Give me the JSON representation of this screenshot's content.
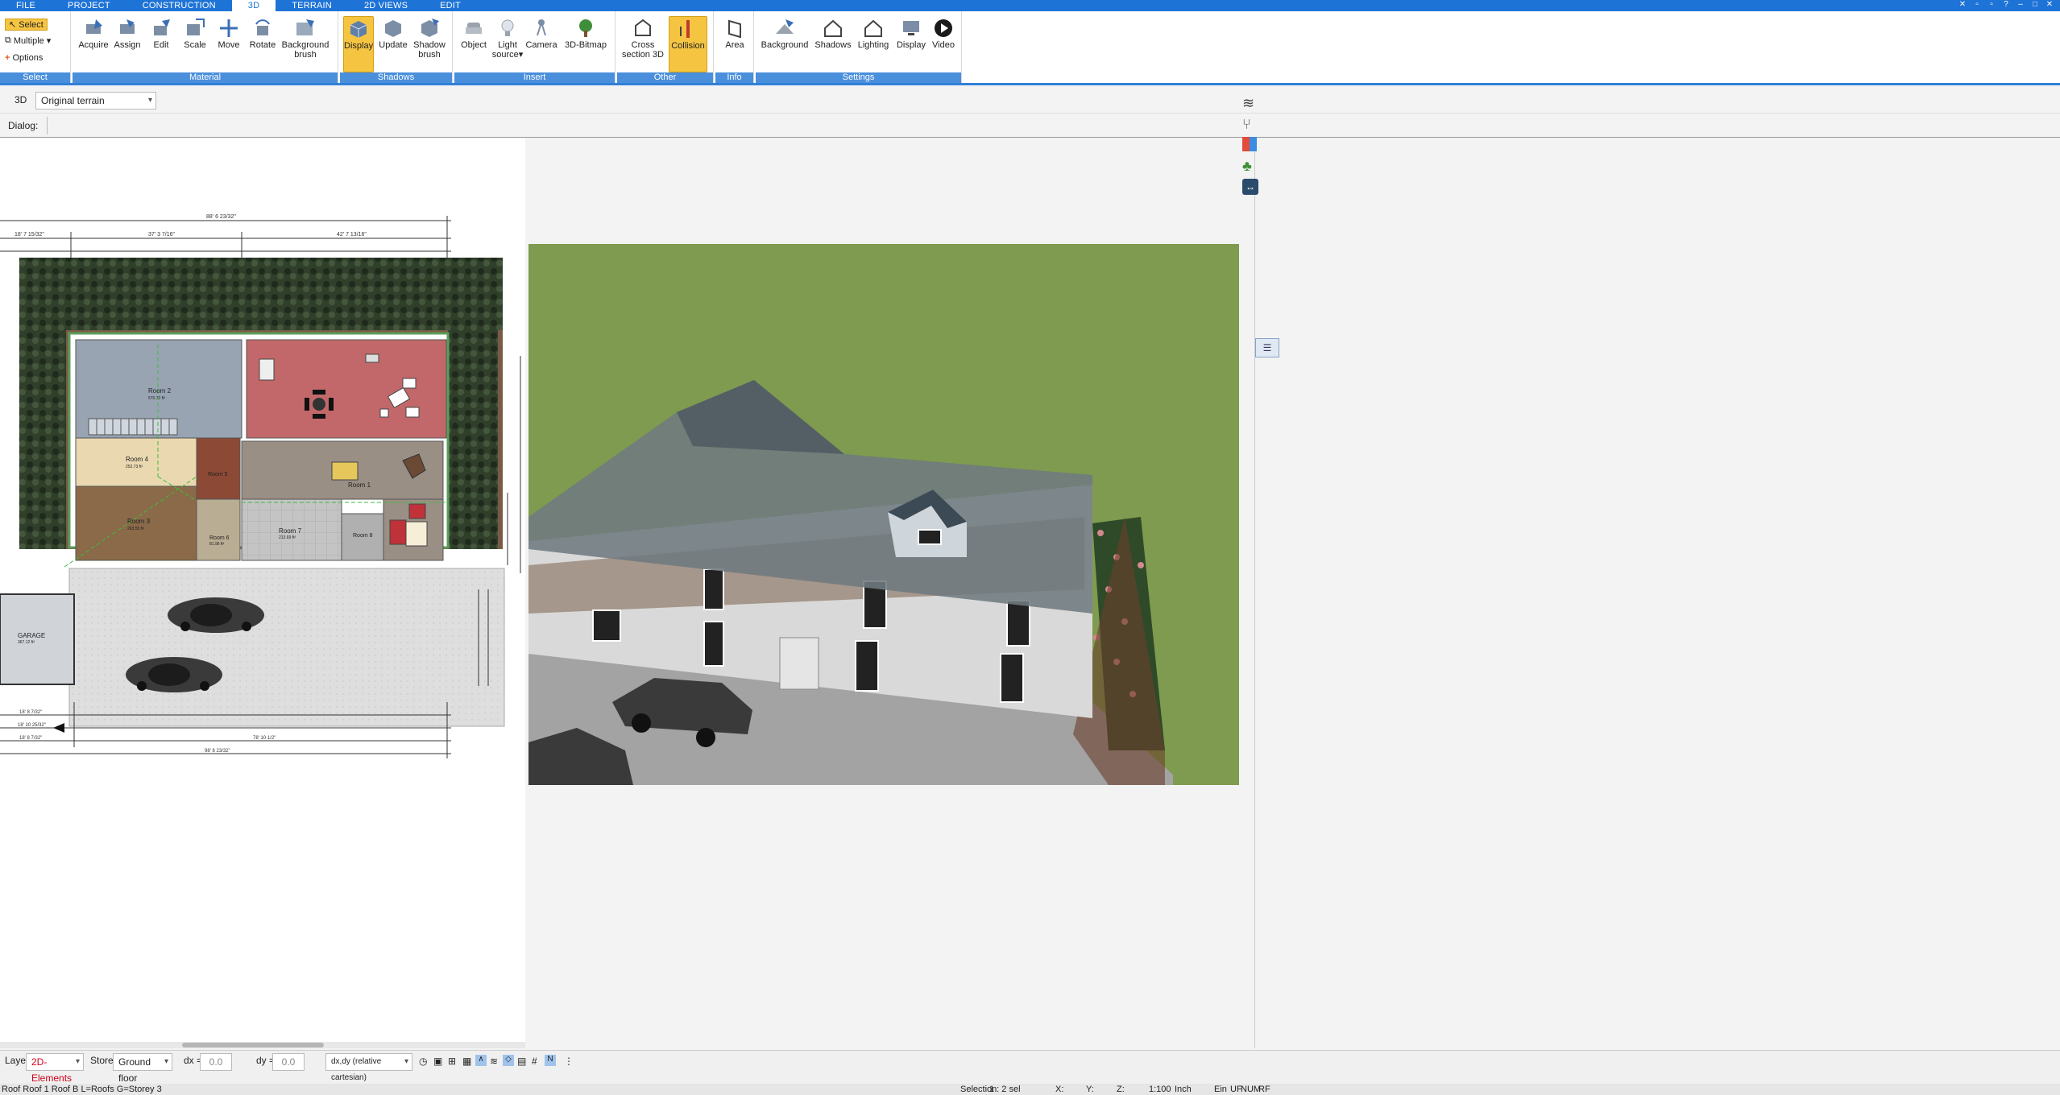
{
  "menu": {
    "tabs": [
      "FILE",
      "PROJECT",
      "CONSTRUCTION",
      "3D",
      "TERRAIN",
      "2D VIEWS",
      "EDIT"
    ],
    "active": "3D"
  },
  "ribbon": {
    "select_group": {
      "select": "Select",
      "multiple": "Multiple",
      "options": "Options",
      "label": "Select"
    },
    "material": {
      "label": "Material",
      "buttons": [
        "Acquire",
        "Assign",
        "Edit",
        "Scale",
        "Move",
        "Rotate",
        "Background brush"
      ]
    },
    "shadows": {
      "label": "Shadows",
      "buttons": [
        "Display",
        "Update",
        "Shadow brush"
      ]
    },
    "insert": {
      "label": "Insert",
      "buttons": [
        "Object",
        "Light source",
        "Camera",
        "3D-Bitmap"
      ]
    },
    "other": {
      "label": "Other",
      "buttons": [
        "Cross section 3D",
        "Collision"
      ]
    },
    "info": {
      "label": "Info",
      "buttons": [
        "Area"
      ]
    },
    "settings": {
      "label": "Settings",
      "buttons": [
        "Background",
        "Shadows",
        "Lighting",
        "Display",
        "Video"
      ]
    }
  },
  "toolbar2": {
    "mode": "3D",
    "terrain_value": "Original terrain"
  },
  "toolbar3": {
    "dialog_label": "Dialog:"
  },
  "plan": {
    "rooms": [
      {
        "name": "Room 2",
        "area": "570.72 ft²"
      },
      {
        "name": "Room 4",
        "area": "252.73 ft²"
      },
      {
        "name": "Room 3",
        "area": "263.55 ft²"
      },
      {
        "name": "Room 5",
        "area": "145.78 ft²"
      },
      {
        "name": "Room 1",
        "area": "..."
      },
      {
        "name": "Room 6",
        "area": "81.96 ft²"
      },
      {
        "name": "Room 7",
        "area": "213.69 ft²"
      },
      {
        "name": "Room 8",
        "area": "..."
      },
      {
        "name": "GARAGE",
        "area": "367.12 ft²"
      }
    ],
    "dimensions": {
      "top_total": "88' 6 23/32\"",
      "top_left": "37' 3 7/16\"",
      "top_right": "42' 7 13/16\"",
      "left_small": "18' 7 15/32\"",
      "bottom_total": "98' 6 23/32\"",
      "bottom_mid": "78' 10 1/2\"",
      "bottom_left": "18' 8 7/32\"",
      "bottom_left2": "18' 10 25/32\"",
      "bottom_left3": "18' 8 7/32\""
    }
  },
  "bottombar": {
    "layer_label": "Layer :",
    "layer_value": "2D-Elements",
    "storey_label": "Storey :",
    "storey_value": "Ground floor",
    "dx_label": "dx =",
    "dx_value": "0.0",
    "dy_label": "dy =",
    "dy_value": "0.0",
    "coord_mode": "dx,dy (relative cartesian)"
  },
  "status": {
    "left": "Roof Roof 1 Roof B L=Roofs G=Storey 3",
    "selection": "Selection",
    "selection_count": "1 : 2 sel",
    "x": "X:",
    "y": "Y:",
    "z": "Z:",
    "scale": "1:100",
    "unit": "Inch",
    "ein": "Ein",
    "uf": "UF",
    "num": "NUM",
    "rf": "RF"
  },
  "colors": {
    "accent": "#1e73d6",
    "active": "#f5c542",
    "layer_text": "#d0021b"
  }
}
